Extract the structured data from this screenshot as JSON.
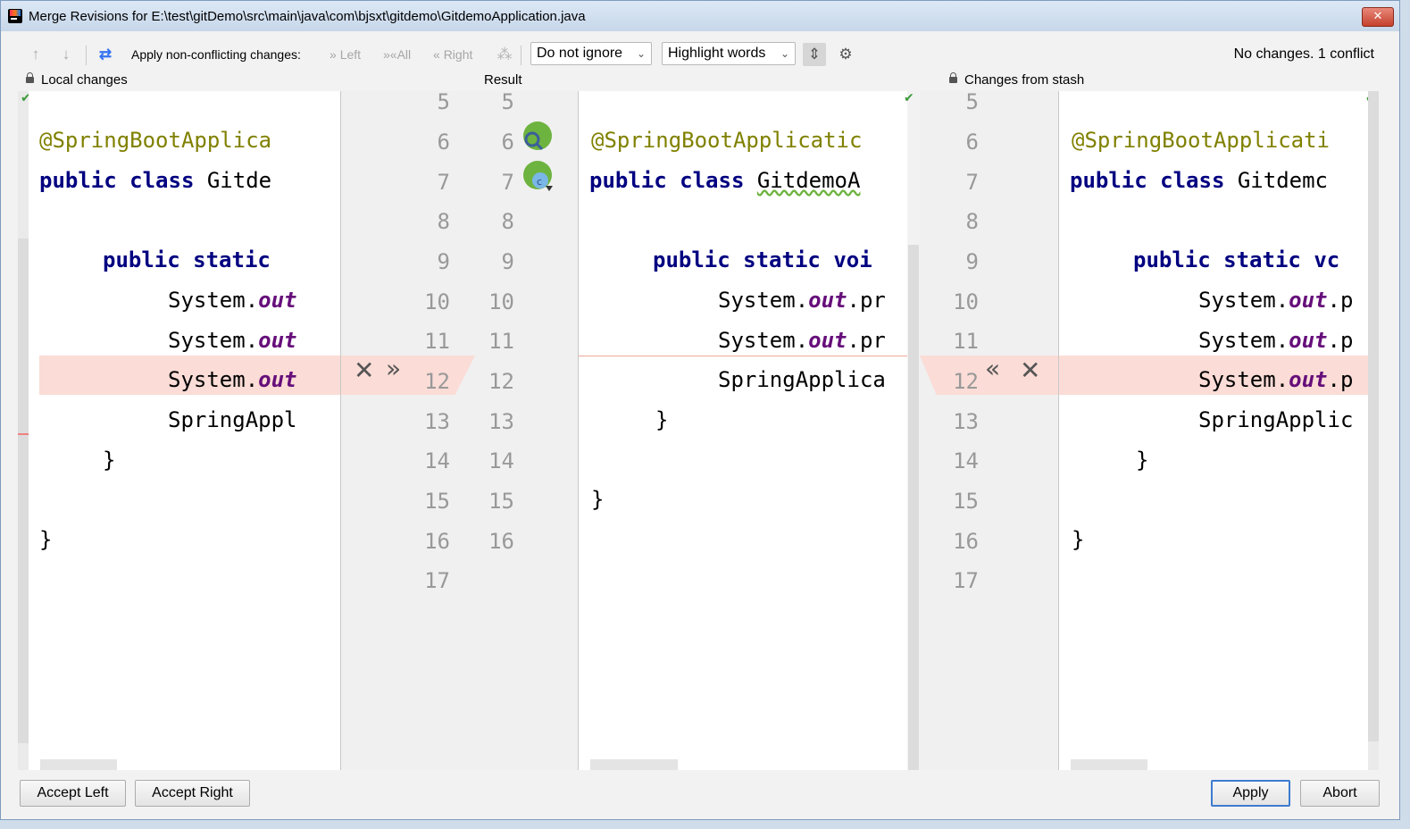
{
  "window": {
    "title": "Merge Revisions for E:\\test\\gitDemo\\src\\main\\java\\com\\bjsxt\\gitdemo\\GitdemoApplication.java",
    "close_label": "✕"
  },
  "toolbar": {
    "apply_label": "Apply non-conflicting changes:",
    "left_label": "Left",
    "all_label": "All",
    "right_label": "Right",
    "ignore_value": "Do not ignore",
    "highlight_value": "Highlight words",
    "status": "No changes. 1 conflict"
  },
  "panels": {
    "left_title": "Local changes",
    "middle_title": "Result",
    "right_title": "Changes from stash"
  },
  "left_lines": [
    "@SpringBootApplica",
    "public class Gitde",
    "",
    "public static ",
    "System.out",
    "System.out",
    "System.out",
    "SpringAppl",
    "}",
    "",
    "}"
  ],
  "middle_lines": [
    "@SpringBootApplicatic",
    "public class GitdemoA",
    "",
    "public static voi",
    "System.out.pr",
    "System.out.pr",
    "SpringApplica",
    "}",
    "",
    "}"
  ],
  "right_lines": [
    "@SpringBootApplicati",
    "public class Gitdemc",
    "",
    "public static vc",
    "System.out.p",
    "System.out.p",
    "System.out.p",
    "SpringApplic",
    "}",
    "",
    "}"
  ],
  "line_numbers": {
    "left": [
      "5",
      "6",
      "7",
      "8",
      "9",
      "10",
      "11",
      "12",
      "13",
      "14",
      "15",
      "16",
      "17"
    ],
    "middle": [
      "5",
      "6",
      "7",
      "8",
      "9",
      "10",
      "11",
      "12",
      "13",
      "14",
      "15",
      "16"
    ],
    "right": [
      "5",
      "6",
      "7",
      "8",
      "9",
      "10",
      "11",
      "12",
      "13",
      "14",
      "15",
      "16",
      "17"
    ]
  },
  "code_tokens": {
    "annotation": "@SpringBootApplica",
    "kw_public": "public",
    "kw_class": "class",
    "kw_static": "static",
    "system": "System.",
    "out": "out"
  },
  "buttons": {
    "accept_left": "Accept Left",
    "accept_right": "Accept Right",
    "apply": "Apply",
    "abort": "Abort"
  },
  "colors": {
    "conflict": "#fbdcd6",
    "keyword": "#000080",
    "annotation": "#808000",
    "field": "#660e7a"
  }
}
